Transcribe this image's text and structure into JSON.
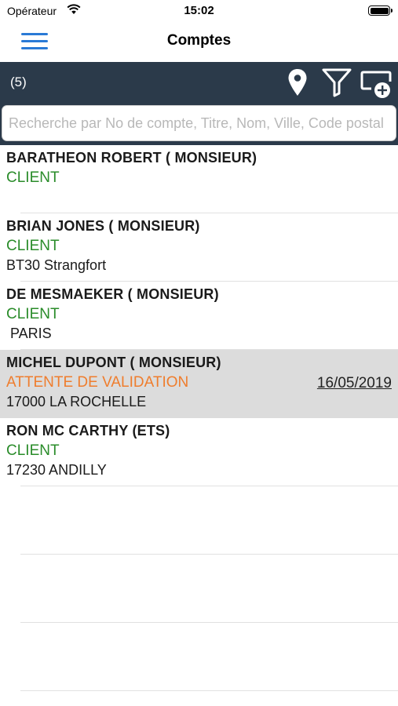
{
  "status_bar": {
    "carrier": "Opérateur",
    "time": "15:02"
  },
  "nav": {
    "title": "Comptes"
  },
  "toolbar": {
    "count": "(5)",
    "icons": [
      "location-pin-icon",
      "filter-icon",
      "add-account-icon"
    ]
  },
  "search": {
    "value": "",
    "placeholder": "Recherche par No de compte, Titre, Nom, Ville, Code postal"
  },
  "accounts": [
    {
      "name": "BARATHEON ROBERT ( MONSIEUR)",
      "status": "CLIENT",
      "address": "",
      "date": ""
    },
    {
      "name": "BRIAN JONES ( MONSIEUR)",
      "status": "CLIENT",
      "address": "BT30 Strangfort",
      "date": ""
    },
    {
      "name": "DE MESMAEKER ( MONSIEUR)",
      "status": "CLIENT",
      "address": " PARIS",
      "date": ""
    },
    {
      "name": "MICHEL DUPONT ( MONSIEUR)",
      "status": "ATTENTE DE VALIDATION",
      "address": "17000 LA ROCHELLE",
      "date": "16/05/2019"
    },
    {
      "name": "RON MC CARTHY (ETS)",
      "status": "CLIENT",
      "address": "17230 ANDILLY",
      "date": ""
    }
  ],
  "colors": {
    "accent_blue": "#2a7ad6",
    "toolbar_bg": "#2b3a4a",
    "status_client": "#2a8c2a",
    "status_pending": "#ef7d2d",
    "selected_row_bg": "#dcdcdc"
  }
}
